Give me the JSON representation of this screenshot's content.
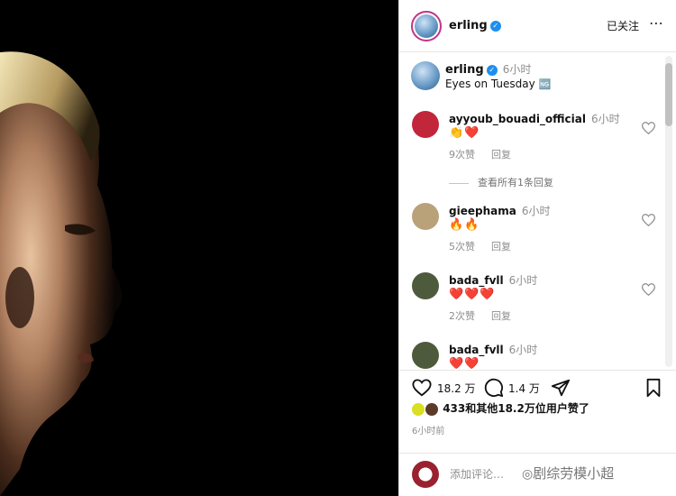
{
  "post": {
    "username": "erling",
    "follow_label": "已关注",
    "more_icon": "⋯"
  },
  "caption": {
    "username": "erling",
    "time": "6小时",
    "text": "Eyes on Tuesday",
    "emoji": "🆖"
  },
  "comments": [
    {
      "username": "ayyoub_bouadi_official",
      "time": "6小时",
      "text": "👏❤️",
      "likes": "9次赞",
      "reply": "回复",
      "avatar_color": "#c2263a"
    },
    {
      "username": "gieephama",
      "time": "6小时",
      "text": "🔥🔥",
      "likes": "5次赞",
      "reply": "回复",
      "avatar_color": "#b9a27a"
    },
    {
      "username": "bada_fvll",
      "time": "6小时",
      "text": "❤️❤️❤️",
      "likes": "2次赞",
      "reply": "回复",
      "avatar_color": "#4e5a3c"
    },
    {
      "username": "bada_fvll",
      "time": "6小时",
      "text": "❤️❤️",
      "likes": "",
      "reply": "",
      "avatar_color": "#4e5a3c"
    }
  ],
  "view_replies": "查看所有1条回复",
  "actions": {
    "like_count": "18.2 万",
    "comment_count": "1.4 万"
  },
  "liked_by": "433和其他18.2万位用户赞了",
  "posted_time": "6小时前",
  "comment_input": {
    "placeholder": "添加评论…"
  },
  "watermark": "剧综劳模小超",
  "colors": {
    "verified": "#1d8ff0",
    "story_ring": "#c13584",
    "meta_gray": "#8e8e8e"
  }
}
